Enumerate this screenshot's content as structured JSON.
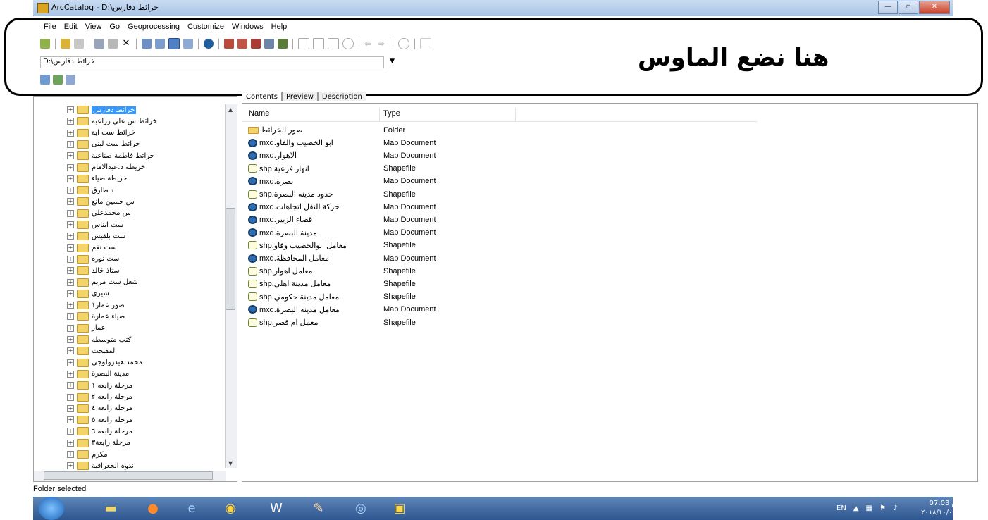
{
  "window": {
    "title": "ArcCatalog - D:\\خرائط دفارس"
  },
  "menu": [
    "File",
    "Edit",
    "View",
    "Go",
    "Geoprocessing",
    "Customize",
    "Windows",
    "Help"
  ],
  "location": {
    "value": "D:\\خرائط دفارس"
  },
  "annotation": "هنا نضع الماوس",
  "tree": {
    "items": [
      "خرائط دفارس",
      "خرائط س علي زراعية",
      "خرائط ست اية",
      "خرائط ست لبنى",
      "خرائط فاطمة صناعية",
      "خريطة د.عبدالامام",
      "خريطة ضياء",
      "د طارق",
      "س حسين مانع",
      "س محمدعلي",
      "ست ايناس",
      "ست بلقيس",
      "ست نغم",
      "ست نوره",
      "ستاذ خالد",
      "شغل ست مريم",
      "شيري",
      "صور عمار١",
      "ضياء عمارة",
      "عمار",
      "كتب متوسطه",
      "لمفيحت",
      "محمد هيدرولوجي",
      "مدينة البصرة",
      "مرحلة رابعه ١",
      "مرحلة رابعه ٢",
      "مرحلة رابعه ٤",
      "مرحلة رابعه ٥",
      "مرحلة رابعه ٦",
      "مرحلة رابعة٣",
      "مكرم",
      "ندوة الجغرافية"
    ]
  },
  "tabs": [
    "Contents",
    "Preview",
    "Description"
  ],
  "columns": {
    "name": "Name",
    "type": "Type"
  },
  "rows": [
    {
      "name": "صور الخرائط",
      "type": "Folder",
      "icon": "folder"
    },
    {
      "name": "ابو الخصيب والفاو.mxd",
      "type": "Map Document",
      "icon": "map"
    },
    {
      "name": "الاهوار.mxd",
      "type": "Map Document",
      "icon": "map"
    },
    {
      "name": "انهار فرعية.shp",
      "type": "Shapefile",
      "icon": "shp"
    },
    {
      "name": "بصرة.mxd",
      "type": "Map Document",
      "icon": "map"
    },
    {
      "name": "حدود مدينه البصرة.shp",
      "type": "Shapefile",
      "icon": "shp"
    },
    {
      "name": "حركة النقل اتجاهات.mxd",
      "type": "Map Document",
      "icon": "map"
    },
    {
      "name": "قضاء الزبير.mxd",
      "type": "Map Document",
      "icon": "map"
    },
    {
      "name": "مدينة البصرة.mxd",
      "type": "Map Document",
      "icon": "map"
    },
    {
      "name": "معامل ابوالخصيب وفاو.shp",
      "type": "Shapefile",
      "icon": "shp"
    },
    {
      "name": "معامل المحافظة.mxd",
      "type": "Map Document",
      "icon": "map"
    },
    {
      "name": "معامل اهوار.shp",
      "type": "Shapefile",
      "icon": "shp"
    },
    {
      "name": "معامل مدينة اهلي.shp",
      "type": "Shapefile",
      "icon": "shp"
    },
    {
      "name": "معامل مدينة حكومي.shp",
      "type": "Shapefile",
      "icon": "shp"
    },
    {
      "name": "معامل مدينه البصرة.mxd",
      "type": "Map Document",
      "icon": "map"
    },
    {
      "name": "معمل ام قصر.shp",
      "type": "Shapefile",
      "icon": "shp"
    }
  ],
  "status": "Folder selected",
  "tray": {
    "lang": "EN",
    "time": "07:03 م",
    "date": "٢٠١٨/١٠/٠٥"
  }
}
